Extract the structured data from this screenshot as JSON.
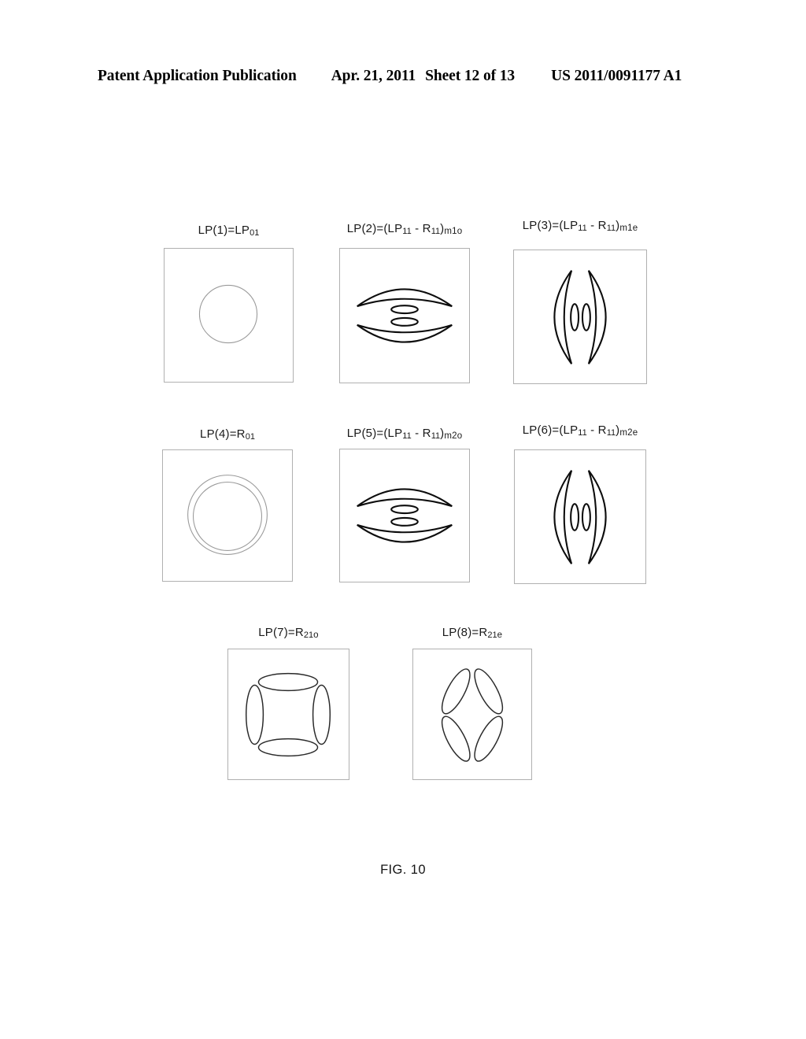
{
  "header": {
    "publication": "Patent Application Publication",
    "date": "Apr. 21, 2011",
    "sheet": "Sheet 12 of 13",
    "patent_number": "US 2011/0091177 A1"
  },
  "figure": {
    "caption": "FIG. 10",
    "panels": [
      {
        "id": "lp1",
        "label_main": "LP(1)=LP",
        "label_sub": "01",
        "label_suffix": "",
        "pattern": "single-circle"
      },
      {
        "id": "lp2",
        "label_main": "LP(2)=(LP",
        "label_sub": "11",
        "label_mid": " - R",
        "label_sub2": "11",
        "label_close": ")",
        "label_suffix": "m1o",
        "pattern": "horizontal-lens-two-lobes"
      },
      {
        "id": "lp3",
        "label_main": "LP(3)=(LP",
        "label_sub": "11",
        "label_mid": " - R",
        "label_sub2": "11",
        "label_close": ")",
        "label_suffix": "m1e",
        "pattern": "vertical-lens-two-lobes"
      },
      {
        "id": "lp4",
        "label_main": "LP(4)=R",
        "label_sub": "01",
        "label_suffix": "",
        "pattern": "concentric-rings"
      },
      {
        "id": "lp5",
        "label_main": "LP(5)=(LP",
        "label_sub": "11",
        "label_mid": " - R",
        "label_sub2": "11",
        "label_close": ")",
        "label_suffix": "m2o",
        "pattern": "horizontal-lens-two-lobes"
      },
      {
        "id": "lp6",
        "label_main": "LP(6)=(LP",
        "label_sub": "11",
        "label_mid": " - R",
        "label_sub2": "11",
        "label_close": ")",
        "label_suffix": "m2e",
        "pattern": "vertical-lens-two-lobes"
      },
      {
        "id": "lp7",
        "label_main": "LP(7)=R",
        "label_sub": "21",
        "label_suffix": "o",
        "pattern": "four-ellipses-cross"
      },
      {
        "id": "lp8",
        "label_main": "LP(8)=R",
        "label_sub": "21",
        "label_suffix": "e",
        "pattern": "four-ellipses-diagonal"
      }
    ]
  },
  "colors": {
    "box_border": "#b0b0b0",
    "mode_faint": "#9a9a9a",
    "mode_strong": "#0d0d0d",
    "background": "#ffffff",
    "text": "#000000"
  }
}
